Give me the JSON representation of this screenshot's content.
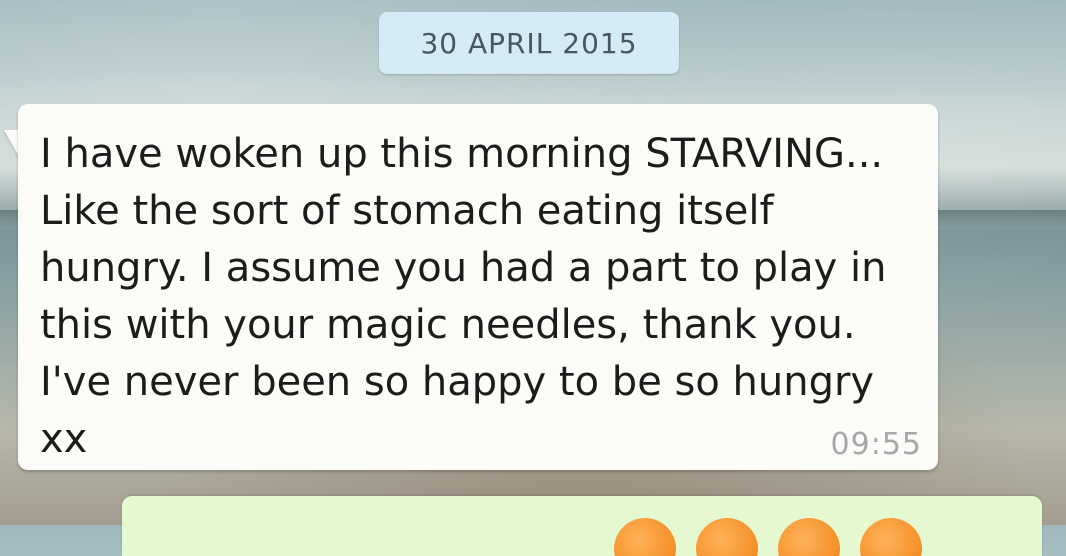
{
  "chat": {
    "date_separator": "30 APRIL 2015",
    "incoming_message": {
      "text": "I have woken up this morning STARVING... Like the sort of stomach eating itself hungry. I assume you had a part to play in this with your magic needles, thank you. I've never been so happy to be so hungry xx",
      "time": "09:55"
    },
    "outgoing_message": {
      "emoji": [
        "emoji-face",
        "emoji-face",
        "emoji-face",
        "emoji-face"
      ]
    }
  },
  "colors": {
    "date_pill_bg": "#d4ebf6",
    "incoming_bubble_bg": "#fbfbf8",
    "outgoing_bubble_bg": "#e6f8cf",
    "timestamp": "#a4a8aa",
    "emoji": "#f5932c"
  }
}
